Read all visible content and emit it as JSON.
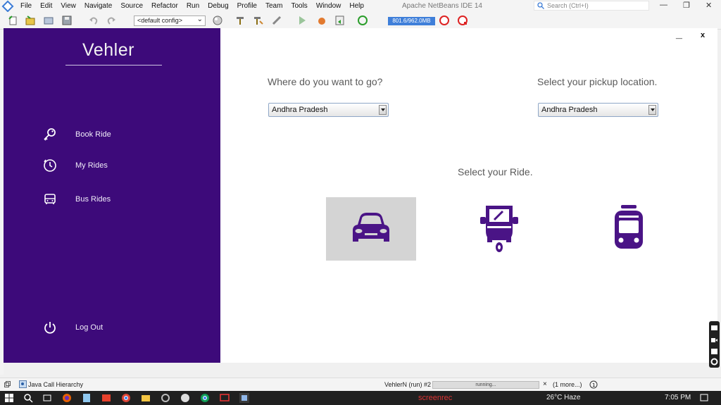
{
  "ide": {
    "menu": [
      "File",
      "Edit",
      "View",
      "Navigate",
      "Source",
      "Refactor",
      "Run",
      "Debug",
      "Profile",
      "Team",
      "Tools",
      "Window",
      "Help"
    ],
    "title": "Apache NetBeans IDE 14",
    "search_placeholder": "Search (Ctrl+I)",
    "config": "<default config>",
    "memory": "801.6/962.0MB",
    "status_left": "Java Call Hierarchy",
    "status_run": "VehlerN (run) #2",
    "status_progress": "running...",
    "status_more": "(1 more...)"
  },
  "app": {
    "brand": "Vehler",
    "nav": [
      {
        "label": "Book Ride",
        "icon": "key-icon"
      },
      {
        "label": "My Rides",
        "icon": "clock-icon"
      },
      {
        "label": "Bus Rides",
        "icon": "bus-icon"
      },
      {
        "label": "Log Out",
        "icon": "power-icon"
      }
    ],
    "destination_label": "Where do you want to go?",
    "destination_value": "Andhra Pradesh",
    "pickup_label": "Select your pickup location.",
    "pickup_value": "Andhra Pradesh",
    "ride_label": "Select your Ride.",
    "rides": [
      {
        "type": "car",
        "icon": "car-icon",
        "selected": true
      },
      {
        "type": "auto-rickshaw",
        "icon": "auto-rickshaw-icon",
        "selected": false
      },
      {
        "type": "train",
        "icon": "train-icon",
        "selected": false
      }
    ],
    "window_min": "_",
    "window_close": "x"
  },
  "taskbar": {
    "weather": "26°C Haze",
    "time": "7:05 PM",
    "watermark": "screenrec"
  },
  "colors": {
    "sidebar": "#3d0a7a",
    "accent": "#4a1486",
    "selected_ride_bg": "#d4d4d4"
  }
}
